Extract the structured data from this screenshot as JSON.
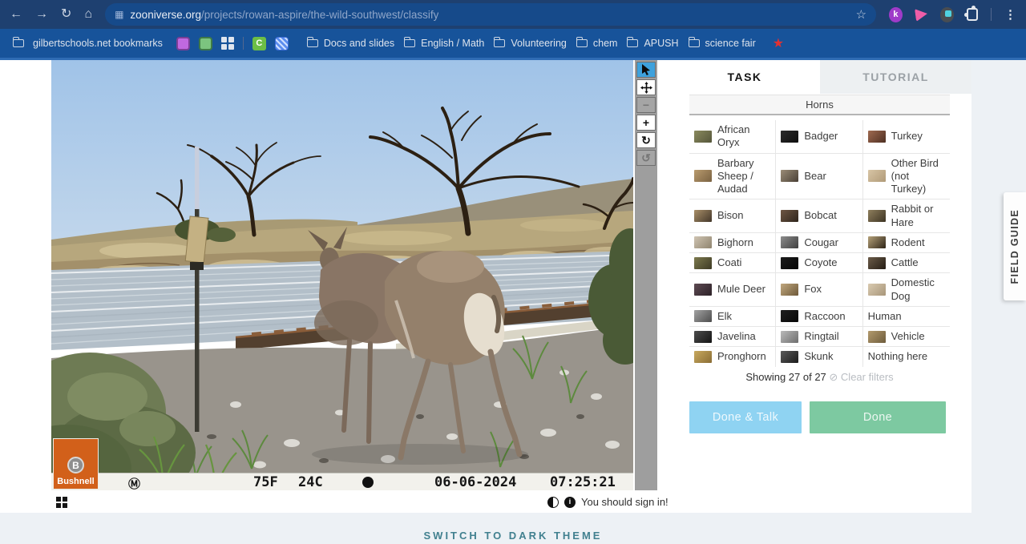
{
  "browser": {
    "url": {
      "host": "zooniverse.org",
      "path": "/projects/rowan-aspire/the-wild-southwest/classify"
    },
    "bookmarks": {
      "manager_label": "gilbertschools.net bookmarks",
      "folders": [
        "Docs and slides",
        "English / Math",
        "Volunteering",
        "chem",
        "APUSH",
        "science fair"
      ]
    },
    "extensions": {
      "kami_label": "k"
    }
  },
  "viewer": {
    "camera_overlay": {
      "brand": "Bushnell",
      "brand_initial": "B",
      "mode_symbol": "Ⓜ",
      "temperature_f": "75F",
      "temperature_c": "24C",
      "date": "06-06-2024",
      "time": "07:25:21"
    },
    "toolbar_icons": [
      "pointer-icon",
      "pan-icon",
      "zoom-out-icon",
      "zoom-in-icon",
      "rotate-icon",
      "reset-icon"
    ],
    "signin_message": "You should sign in!"
  },
  "task_panel": {
    "tabs": [
      {
        "label": "TASK"
      },
      {
        "label": "TUTORIAL"
      }
    ],
    "filter_header": "Horns",
    "choices": [
      {
        "label": "African Oryx",
        "thumb": [
          "#8a8a5e",
          "#55563a"
        ]
      },
      {
        "label": "Badger",
        "thumb": [
          "#2b2b2b",
          "#0e0e0e"
        ]
      },
      {
        "label": "Turkey",
        "thumb": [
          "#a06a50",
          "#4e2f22"
        ]
      },
      {
        "label": "Barbary Sheep / Audad",
        "thumb": [
          "#b99b6e",
          "#7a6242"
        ]
      },
      {
        "label": "Bear",
        "thumb": [
          "#9b8d77",
          "#4a4036"
        ]
      },
      {
        "label": "Other Bird (not Turkey)",
        "thumb": [
          "#d8c5a5",
          "#b09a78"
        ]
      },
      {
        "label": "Bison",
        "thumb": [
          "#a98f68",
          "#43372a"
        ]
      },
      {
        "label": "Bobcat",
        "thumb": [
          "#6e5643",
          "#2f251c"
        ]
      },
      {
        "label": "Rabbit or Hare",
        "thumb": [
          "#8f7f5d",
          "#3d3423"
        ]
      },
      {
        "label": "Bighorn",
        "thumb": [
          "#cfc4b2",
          "#8f846f"
        ]
      },
      {
        "label": "Cougar",
        "thumb": [
          "#8c8c8c",
          "#3f3f3f"
        ]
      },
      {
        "label": "Rodent",
        "thumb": [
          "#b5a179",
          "#2e2417"
        ]
      },
      {
        "label": "Coati",
        "thumb": [
          "#7d7a4e",
          "#3d3a24"
        ]
      },
      {
        "label": "Coyote",
        "thumb": [
          "#1c1c1c",
          "#050505"
        ]
      },
      {
        "label": "Cattle",
        "thumb": [
          "#6b5b48",
          "#241c14"
        ]
      },
      {
        "label": "Mule Deer",
        "thumb": [
          "#5d4a52",
          "#2d2228"
        ]
      },
      {
        "label": "Fox",
        "thumb": [
          "#c0a77e",
          "#6f5a3a"
        ]
      },
      {
        "label": "Domestic Dog",
        "thumb": [
          "#d9cab0",
          "#a8967a"
        ]
      },
      {
        "label": "Elk",
        "thumb": [
          "#a3a3a3",
          "#4d4d4d"
        ]
      },
      {
        "label": "Raccoon",
        "thumb": [
          "#1f1f1f",
          "#070707"
        ]
      },
      {
        "label": "Human",
        "thumb": null
      },
      {
        "label": "Javelina",
        "thumb": [
          "#4d4d4d",
          "#141414"
        ]
      },
      {
        "label": "Ringtail",
        "thumb": [
          "#b9b9b9",
          "#6e6e6e"
        ]
      },
      {
        "label": "Vehicle",
        "thumb": [
          "#b39a6d",
          "#6e5c3c"
        ]
      },
      {
        "label": "Pronghorn",
        "thumb": [
          "#c8a95e",
          "#8a6d35"
        ]
      },
      {
        "label": "Skunk",
        "thumb": [
          "#5a5a5a",
          "#1b1b1b"
        ]
      },
      {
        "label": "Nothing here",
        "thumb": null
      }
    ],
    "showing_text": "Showing 27 of 27",
    "clear_filters_icon": "slashed-circle-icon",
    "clear_filters_label": "Clear filters",
    "buttons": {
      "done_talk": "Done & Talk",
      "done": "Done"
    }
  },
  "field_guide_label": "FIELD GUIDE",
  "theme_toggle_label": "SWITCH TO DARK THEME",
  "colors": {
    "done_talk_bg": "#8fd3f2",
    "done_bg": "#7dc9a1",
    "toolbar_active_bg": "#3ea1dc",
    "bushnell_orange": "#d2601a",
    "theme_link": "#41808f"
  }
}
